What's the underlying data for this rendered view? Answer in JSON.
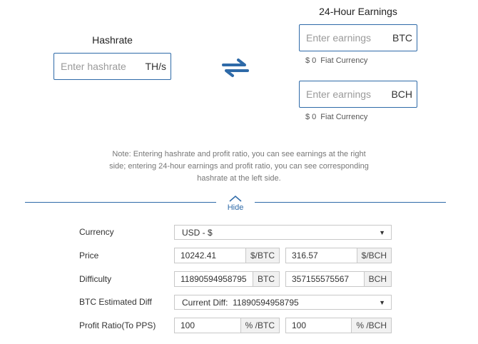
{
  "hashrate": {
    "title": "Hashrate",
    "placeholder": "Enter hashrate",
    "unit": "TH/s"
  },
  "earnings": {
    "title": "24-Hour Earnings",
    "btc": {
      "placeholder": "Enter earnings",
      "unit": "BTC",
      "fiat_value": "$ 0",
      "fiat_label": "Fiat Currency"
    },
    "bch": {
      "placeholder": "Enter earnings",
      "unit": "BCH",
      "fiat_value": "$ 0",
      "fiat_label": "Fiat Currency"
    }
  },
  "note": {
    "line1": "Note: Entering hashrate and profit ratio, you can see earnings at the right",
    "line2": "side; entering 24-hour earnings and profit ratio, you can see corresponding",
    "line3": "hashrate at the left side."
  },
  "toggle": {
    "label": "Hide"
  },
  "settings": {
    "currency": {
      "label": "Currency",
      "value": "USD - $"
    },
    "price": {
      "label": "Price",
      "btc_value": "10242.41",
      "btc_unit": "$/BTC",
      "bch_value": "316.57",
      "bch_unit": "$/BCH"
    },
    "difficulty": {
      "label": "Difficulty",
      "btc_value": "11890594958795",
      "btc_unit": "BTC",
      "bch_value": "357155575567",
      "bch_unit": "BCH"
    },
    "btc_diff": {
      "label": "BTC Estimated Diff",
      "value": "Current Diff:  11890594958795"
    },
    "profit": {
      "label": "Profit Ratio(To PPS)",
      "btc_value": "100",
      "btc_unit": "% /BTC",
      "bch_value": "100",
      "bch_unit": "% /BCH"
    }
  },
  "colors": {
    "accent": "#2e6aa8"
  }
}
